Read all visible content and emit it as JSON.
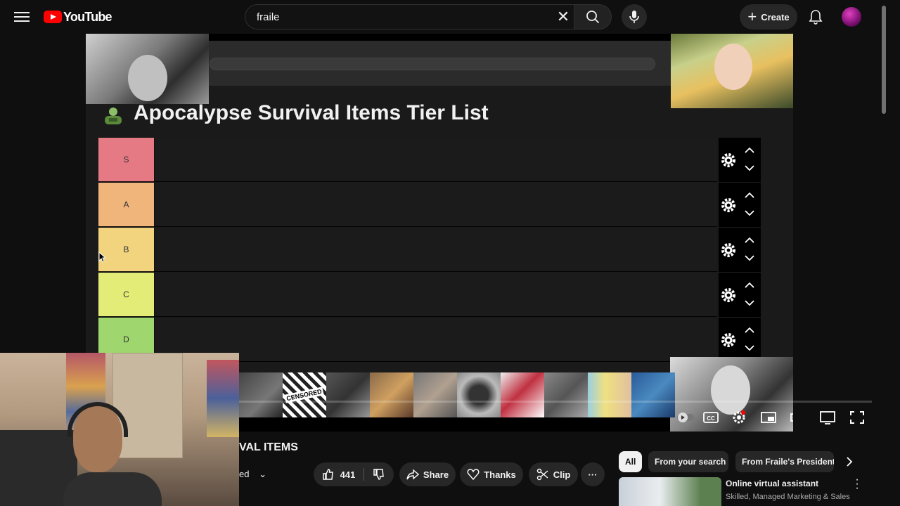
{
  "masthead": {
    "logo_text": "YouTube",
    "search_value": "fraile",
    "create_label": "Create"
  },
  "player": {
    "tier_title": "Apocalypse Survival Items Tier List",
    "tiers": [
      {
        "label": "S",
        "color": "#e57a84"
      },
      {
        "label": "A",
        "color": "#f0b57a"
      },
      {
        "label": "B",
        "color": "#f2d47e"
      },
      {
        "label": "C",
        "color": "#e4ec78"
      },
      {
        "label": "D",
        "color": "#9fd66e"
      }
    ],
    "censored_text": "CENSORED"
  },
  "video": {
    "title_partial": "VAL ITEMS",
    "subscribe_partial": "ed",
    "like_count": "441",
    "share_label": "Share",
    "thanks_label": "Thanks",
    "clip_label": "Clip"
  },
  "filters": {
    "chips": [
      "All",
      "From your search",
      "From Fraile's Presidents"
    ]
  },
  "recommendation": {
    "title": "Online virtual assistant",
    "subtitle": "Skilled, Managed Marketing & Sales"
  },
  "colors": {
    "background": "#0f0f0f",
    "brand_red": "#ff0000"
  }
}
